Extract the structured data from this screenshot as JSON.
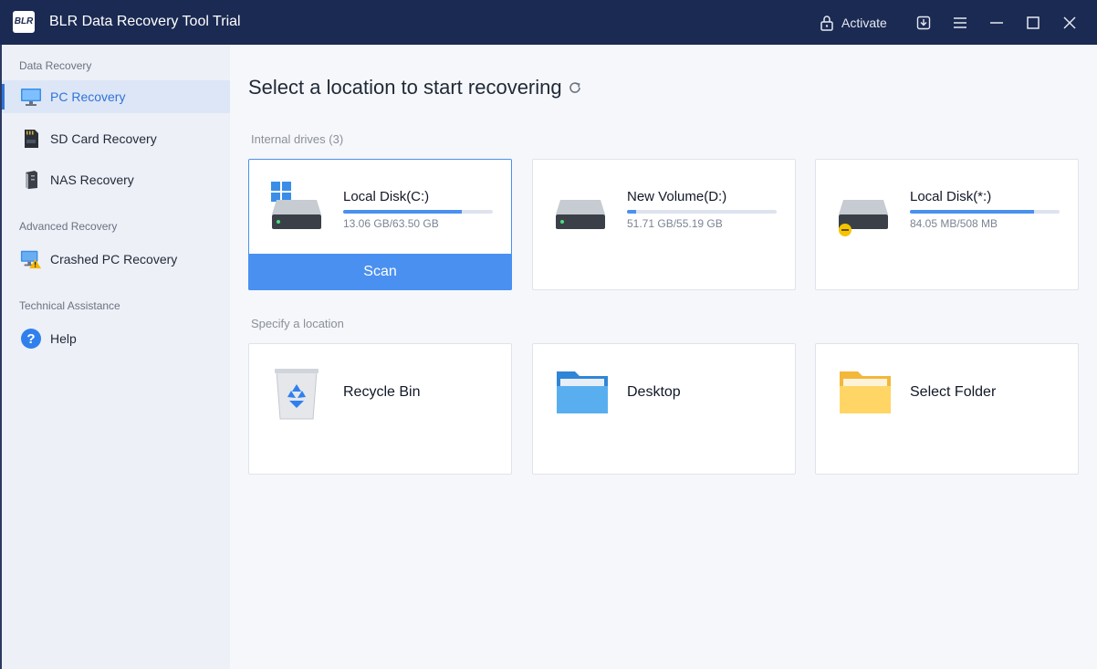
{
  "window": {
    "title": "BLR Data Recovery Tool Trial",
    "logo_text": "BLR",
    "activate_label": "Activate"
  },
  "sidebar": {
    "sections": [
      {
        "label": "Data Recovery"
      },
      {
        "label": "Advanced Recovery"
      },
      {
        "label": "Technical Assistance"
      }
    ],
    "items": [
      {
        "label": "PC Recovery",
        "icon": "monitor-icon",
        "active": true
      },
      {
        "label": "SD Card Recovery",
        "icon": "sd-card-icon"
      },
      {
        "label": "NAS Recovery",
        "icon": "nas-icon"
      },
      {
        "label": "Crashed PC Recovery",
        "icon": "crashed-pc-icon"
      },
      {
        "label": "Help",
        "icon": "help-icon"
      }
    ]
  },
  "main": {
    "title": "Select a location to start recovering",
    "internal_label": "Internal drives (3)",
    "specify_label": "Specify a location",
    "scan_label": "Scan",
    "drives": [
      {
        "name": "Local Disk(C:)",
        "size": "13.06 GB/63.50 GB",
        "used_fraction": 0.79
      },
      {
        "name": "New Volume(D:)",
        "size": "51.71 GB/55.19 GB",
        "used_fraction": 0.06
      },
      {
        "name": "Local Disk(*:)",
        "size": "84.05 MB/508 MB",
        "used_fraction": 0.83
      }
    ],
    "locations": [
      {
        "name": "Recycle Bin",
        "icon": "recycle-bin-icon"
      },
      {
        "name": "Desktop",
        "icon": "desktop-folder-icon"
      },
      {
        "name": "Select Folder",
        "icon": "folder-icon"
      }
    ]
  },
  "colors": {
    "accent": "#4a90f0",
    "titlebar": "#1b2a52",
    "sidebar": "#edf0f7"
  }
}
